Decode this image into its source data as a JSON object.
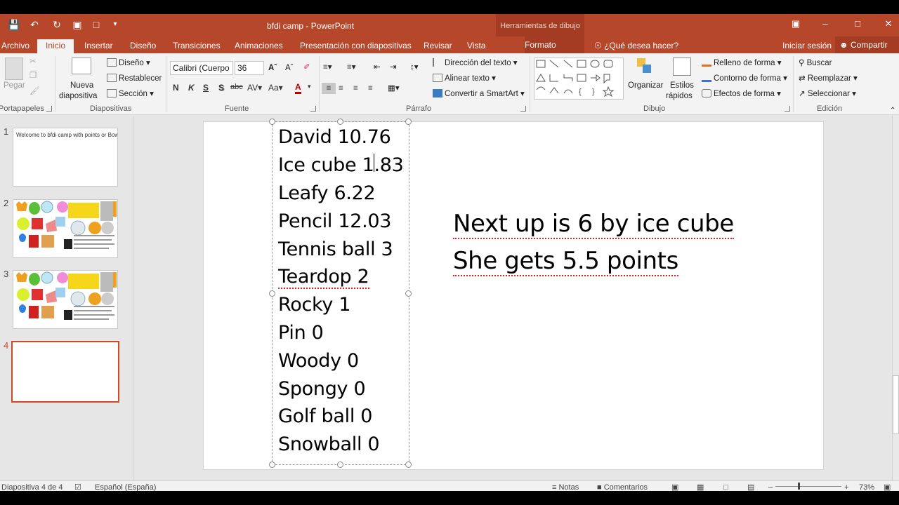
{
  "window": {
    "title": "bfdi camp - PowerPoint",
    "context_group": "Herramientas de dibujo",
    "controls": [
      "restore-ribbon-icon",
      "minimize-icon",
      "maximize-icon",
      "close-icon"
    ]
  },
  "quick_access": [
    "save-icon",
    "undo-icon",
    "redo-icon",
    "touch-mode-icon",
    "new-file-icon",
    "customize-icon"
  ],
  "tabs": [
    "Archivo",
    "Inicio",
    "Insertar",
    "Diseño",
    "Transiciones",
    "Animaciones",
    "Presentación con diapositivas",
    "Revisar",
    "Vista",
    "Formato"
  ],
  "active_tab": "Inicio",
  "tell_me": "¿Qué desea hacer?",
  "sign_in": "Iniciar sesión",
  "share": "Compartir",
  "ribbon": {
    "clipboard": {
      "paste": "Pegar",
      "label": "Portapapeles"
    },
    "slides": {
      "new_slide_line1": "Nueva",
      "new_slide_line2": "diapositiva",
      "layout": "Diseño",
      "reset": "Restablecer",
      "section": "Sección",
      "label": "Diapositivas"
    },
    "font": {
      "name": "Calibri (Cuerpo",
      "size": "36",
      "bold": "N",
      "italic": "K",
      "underline": "S",
      "shadow": "S",
      "strike": "abc",
      "label": "Fuente"
    },
    "paragraph": {
      "text_direction": "Dirección del texto",
      "align_text": "Alinear texto",
      "smartart": "Convertir a SmartArt",
      "label": "Párrafo"
    },
    "drawing": {
      "arrange": "Organizar",
      "styles_line1": "Estilos",
      "styles_line2": "rápidos",
      "fill": "Relleno de forma",
      "outline": "Contorno de forma",
      "effects": "Efectos de forma",
      "label": "Dibujo"
    },
    "editing": {
      "find": "Buscar",
      "replace": "Reemplazar",
      "select": "Seleccionar",
      "label": "Edición"
    }
  },
  "thumbnails": [
    {
      "num": "1",
      "text": "Welcome to bfdi camp with points or Bow"
    },
    {
      "num": "2",
      "text": ""
    },
    {
      "num": "3",
      "text": ""
    },
    {
      "num": "4",
      "text": ""
    }
  ],
  "slide": {
    "scores": [
      "David 10.76",
      "Ice cube 1.83",
      "Leafy 6.22",
      "Pencil 12.03",
      "Tennis ball 3",
      "Teardop 2",
      "Rocky 1",
      "Pin 0",
      "Woody 0",
      "Spongy 0",
      "Golf ball 0",
      "Snowball 0"
    ],
    "message_line1": "Next up is 6 by ice cube",
    "message_line2": "She gets 5.5 points"
  },
  "status": {
    "slide_info": "Diapositiva 4 de 4",
    "language": "Español (España)",
    "notes": "Notas",
    "comments": "Comentarios",
    "zoom": "73%"
  }
}
